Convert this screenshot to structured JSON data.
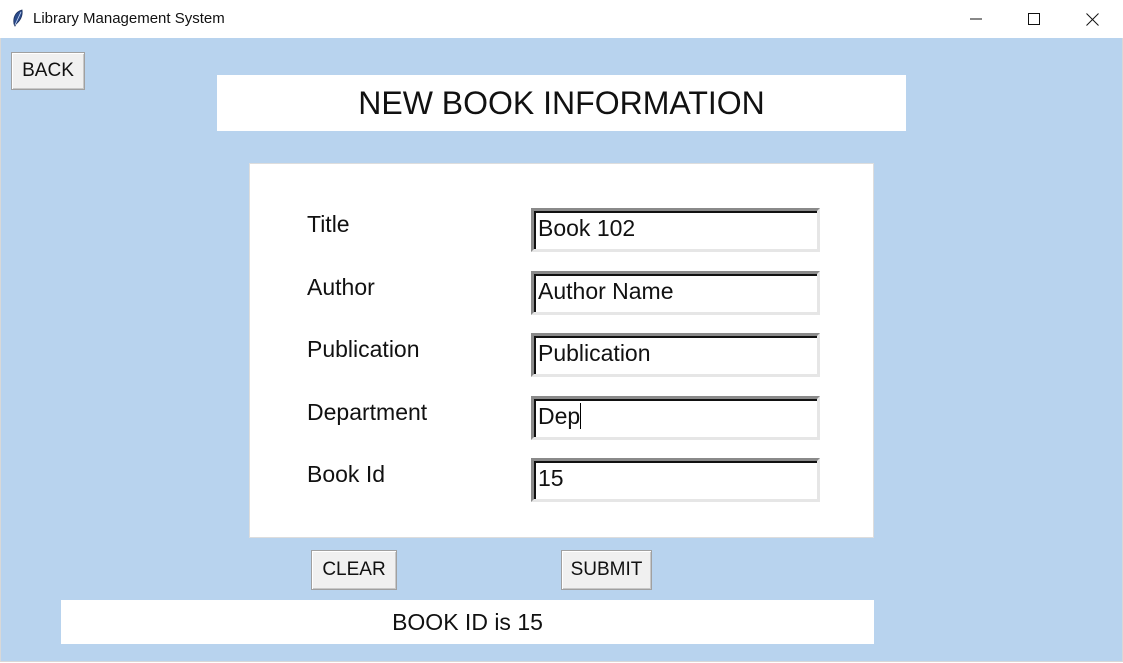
{
  "window": {
    "title": "Library Management System",
    "icon": "feather-icon",
    "controls": [
      "minimize-icon",
      "maximize-icon",
      "close-icon"
    ]
  },
  "colors": {
    "background": "#b8d3ee",
    "panel": "#ffffff",
    "button": "#f0f0f0"
  },
  "back_label": "BACK",
  "heading": "NEW BOOK INFORMATION",
  "form": {
    "fields": [
      {
        "label": "Title",
        "value": "Book 102"
      },
      {
        "label": "Author",
        "value": "Author Name"
      },
      {
        "label": "Publication",
        "value": "Publication"
      },
      {
        "label": "Department",
        "value": "Dep"
      },
      {
        "label": "Book Id",
        "value": "15"
      }
    ]
  },
  "buttons": {
    "clear": "CLEAR",
    "submit": "SUBMIT"
  },
  "status": "BOOK ID is 15"
}
